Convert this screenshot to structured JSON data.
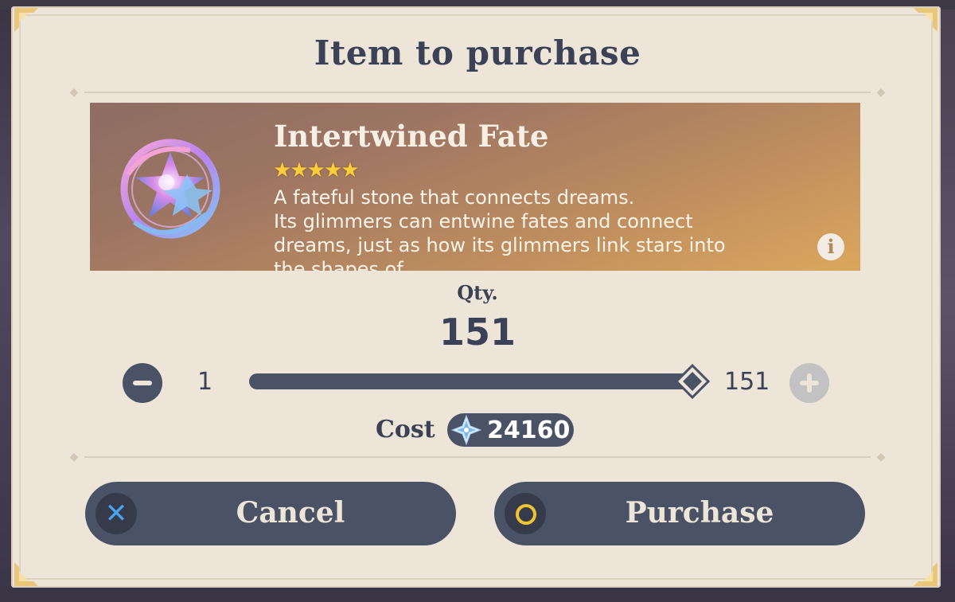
{
  "dialog": {
    "title": "Item to purchase"
  },
  "item": {
    "name": "Intertwined Fate",
    "rarity_stars": "★★★★★",
    "rarity": 5,
    "description_line1": "A fateful stone that connects dreams.",
    "description_line2": "Its glimmers can entwine fates and connect",
    "description_line3": "dreams, just as how its glimmers link stars into",
    "description_line4": "the shapes of ...",
    "info_icon": "info-icon"
  },
  "quantity": {
    "label": "Qty.",
    "value": "151",
    "min": "1",
    "max": "151",
    "slider_fraction": 1.0
  },
  "cost": {
    "label": "Cost",
    "value": "24160",
    "currency_icon": "primogem-icon"
  },
  "buttons": {
    "cancel_label": "Cancel",
    "cancel_icon": "x-icon",
    "purchase_label": "Purchase",
    "purchase_icon": "circle-icon"
  },
  "colors": {
    "panel": "#ece5d8",
    "text": "#3b4255",
    "button": "#4a5266",
    "star": "#ffcd3a",
    "x_icon": "#4aa5ea",
    "o_icon": "#f0c430"
  }
}
